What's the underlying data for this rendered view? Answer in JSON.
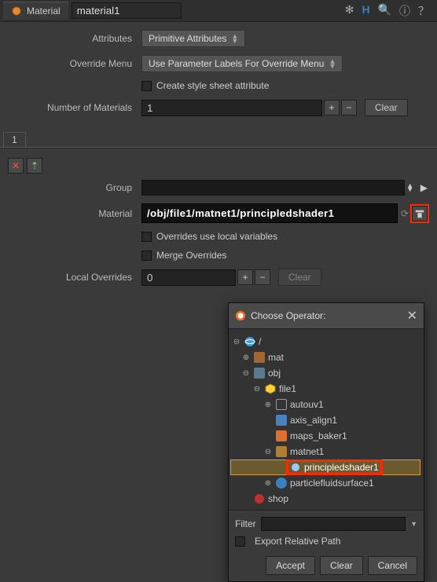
{
  "tab": {
    "label": "Material"
  },
  "title_value": "material1",
  "toolbar": {
    "gear": "gear-icon",
    "h": "H",
    "search": "search-icon",
    "info": "info-icon",
    "help": "help-icon"
  },
  "attributes": {
    "label": "Attributes",
    "value": "Primitive Attributes"
  },
  "override_menu": {
    "label": "Override Menu",
    "value": "Use Parameter Labels For Override Menu"
  },
  "create_style": {
    "label": "Create style sheet attribute",
    "checked": false
  },
  "num_materials": {
    "label": "Number of Materials",
    "value": "1",
    "plus": "+",
    "minus": "−",
    "clear": "Clear"
  },
  "subtab1": "1",
  "group": {
    "label": "Group",
    "value": ""
  },
  "material": {
    "label": "Material",
    "value": "/obj/file1/matnet1/principledshader1"
  },
  "overrides_local": {
    "label": "Overrides use local variables",
    "checked": false
  },
  "merge_overrides": {
    "label": "Merge Overrides",
    "checked": false
  },
  "local_overrides": {
    "label": "Local Overrides",
    "value": "0",
    "plus": "+",
    "minus": "−",
    "clear": "Clear"
  },
  "popup": {
    "title": "Choose Operator:",
    "root": "/",
    "nodes": {
      "mat": "mat",
      "obj": "obj",
      "file1": "file1",
      "autouv1": "autouv1",
      "axis_align1": "axis_align1",
      "maps_baker1": "maps_baker1",
      "matnet1": "matnet1",
      "principledshader1": "principledshader1",
      "particlefluidsurface1": "particlefluidsurface1",
      "shop": "shop"
    },
    "filter_label": "Filter",
    "export_label": "Export Relative Path",
    "accept": "Accept",
    "clear": "Clear",
    "cancel": "Cancel"
  }
}
